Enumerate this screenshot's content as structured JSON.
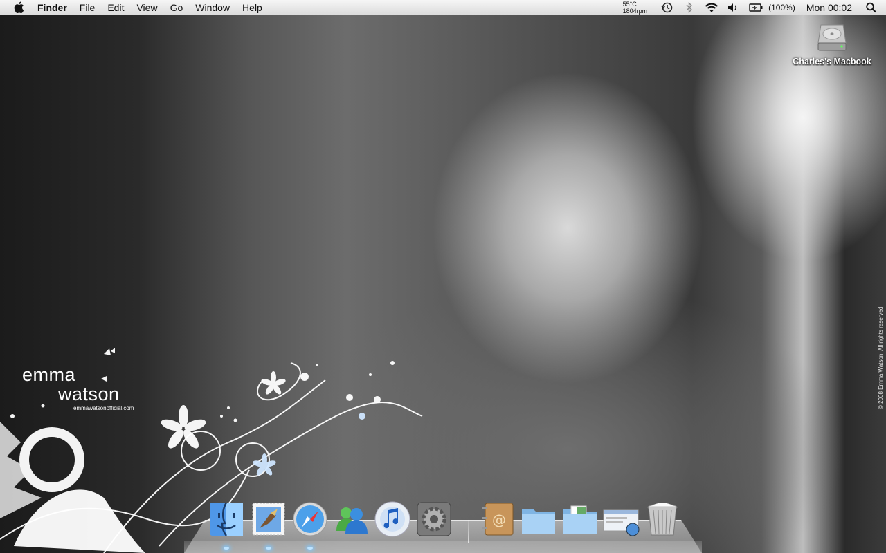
{
  "menubar": {
    "app_name": "Finder",
    "menus": [
      "File",
      "Edit",
      "View",
      "Go",
      "Window",
      "Help"
    ],
    "temperature": "55°C",
    "fan_speed": "1804rpm",
    "battery_percent": "(100%)",
    "clock": "Mon 00:02",
    "icons": [
      "apple-icon",
      "time-machine-icon",
      "bluetooth-icon",
      "wifi-icon",
      "volume-icon",
      "battery-icon",
      "spotlight-icon"
    ]
  },
  "desktop": {
    "drive_label": "Charles's Macbook"
  },
  "wallpaper": {
    "name_first": "emma",
    "name_last": "watson",
    "website": "emmawatsonofficial.com",
    "copyright": "© 2008 Emma Watson. All rights reserved."
  },
  "dock": {
    "items": [
      {
        "name": "Finder",
        "icon": "finder-icon",
        "running": true
      },
      {
        "name": "Mail",
        "icon": "mail-icon",
        "running": true
      },
      {
        "name": "Safari",
        "icon": "safari-icon",
        "running": true
      },
      {
        "name": "Messenger",
        "icon": "messenger-icon",
        "running": false
      },
      {
        "name": "iTunes",
        "icon": "itunes-icon",
        "running": false
      },
      {
        "name": "System Preferences",
        "icon": "system-preferences-icon",
        "running": false
      },
      {
        "name": "Address Book",
        "icon": "address-book-icon",
        "running": false
      },
      {
        "name": "Documents",
        "icon": "folder-icon",
        "running": false
      },
      {
        "name": "Downloads",
        "icon": "folder-icon",
        "running": false
      },
      {
        "name": "Safari Downloads",
        "icon": "downloads-stack-icon",
        "running": false
      },
      {
        "name": "Trash",
        "icon": "trash-icon",
        "running": false
      }
    ]
  }
}
